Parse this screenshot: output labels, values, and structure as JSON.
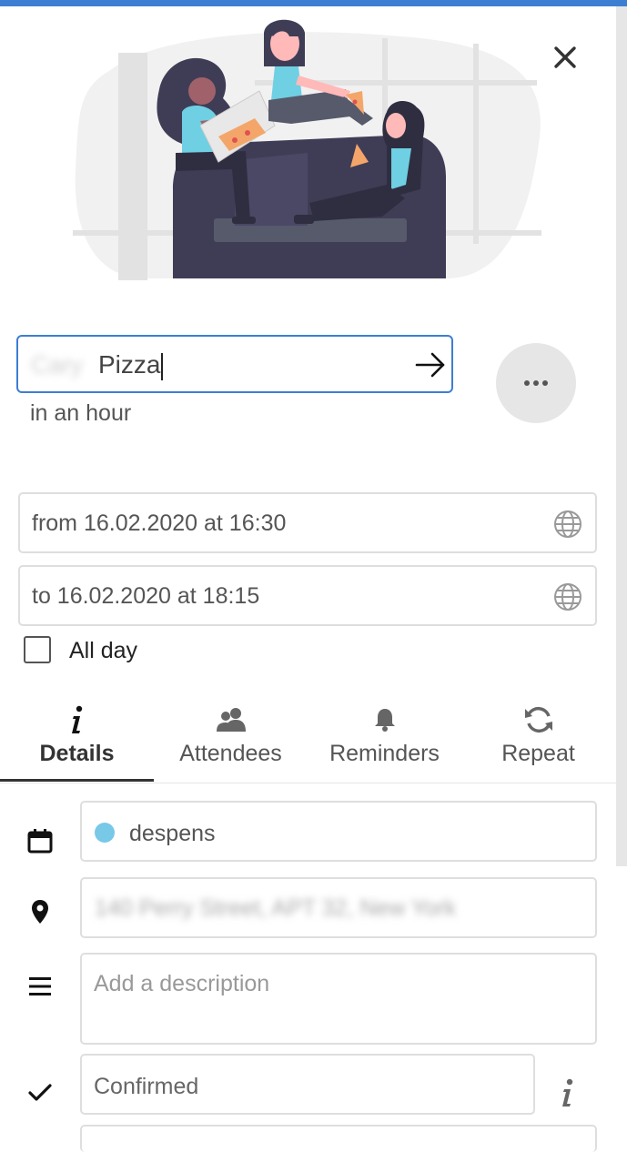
{
  "title": {
    "blurred_prefix": "Cary",
    "value": "Pizza"
  },
  "relative_time": "in an hour",
  "start": "from 16.02.2020 at 16:30",
  "end": "to 16.02.2020 at 18:15",
  "all_day_label": "All day",
  "tabs": [
    {
      "label": "Details",
      "icon": "info-icon",
      "active": true
    },
    {
      "label": "Attendees",
      "icon": "people-icon",
      "active": false
    },
    {
      "label": "Reminders",
      "icon": "bell-icon",
      "active": false
    },
    {
      "label": "Repeat",
      "icon": "refresh-icon",
      "active": false
    }
  ],
  "details": {
    "calendar": {
      "name": "despens",
      "color": "#78c8e8"
    },
    "location": "140 Perry Street, APT 32, New York",
    "description_placeholder": "Add a description",
    "status": "Confirmed"
  },
  "colors": {
    "accent": "#3d7ed3",
    "sofa": "#3f3d56",
    "shirt": "#6fcfe3",
    "pizza": "#f4a66a"
  }
}
